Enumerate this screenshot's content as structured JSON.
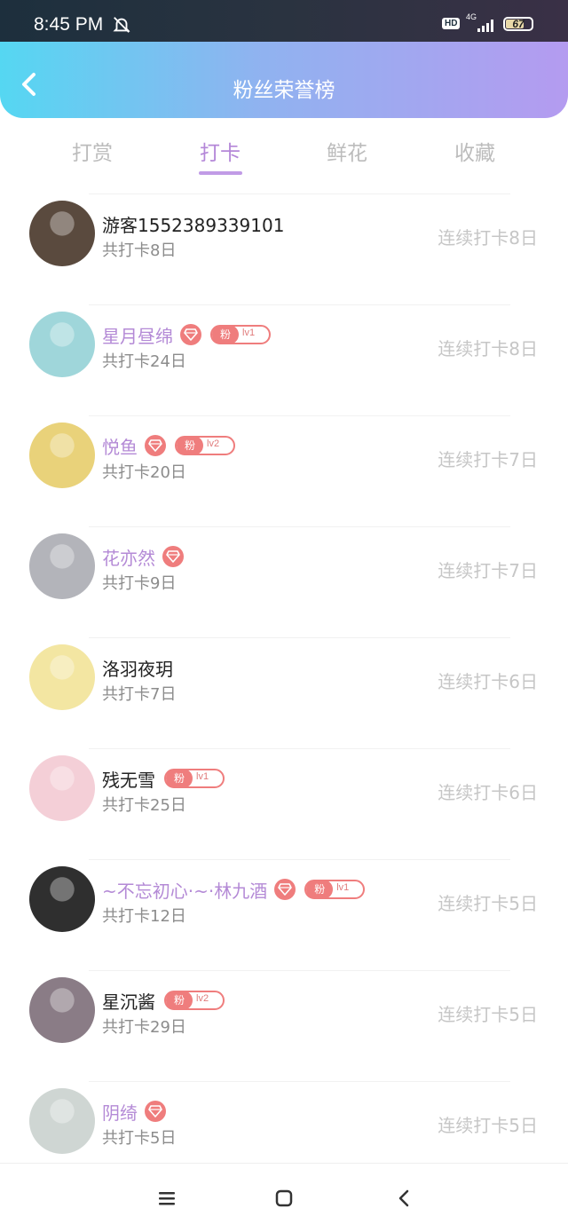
{
  "status_bar": {
    "time": "8:45 PM",
    "hd": "HD",
    "network": "4G",
    "battery": "67"
  },
  "header": {
    "title": "粉丝荣誉榜"
  },
  "tabs": [
    {
      "label": "打赏",
      "active": false
    },
    {
      "label": "打卡",
      "active": true
    },
    {
      "label": "鲜花",
      "active": false
    },
    {
      "label": "收藏",
      "active": false
    }
  ],
  "rows": [
    {
      "name": "游客1552389339101",
      "vip": false,
      "diamond": false,
      "fan_tag": "",
      "level": "",
      "total": "共打卡8日",
      "streak": "连续打卡8日",
      "avatar_color": "#5a4a3e"
    },
    {
      "name": "星月昼绵",
      "vip": true,
      "diamond": true,
      "fan_tag": "粉",
      "level": "lv1",
      "total": "共打卡24日",
      "streak": "连续打卡8日",
      "avatar_color": "#9fd6da"
    },
    {
      "name": "悦鱼",
      "vip": true,
      "diamond": true,
      "fan_tag": "粉",
      "level": "lv2",
      "total": "共打卡20日",
      "streak": "连续打卡7日",
      "avatar_color": "#e9d27a"
    },
    {
      "name": "花亦然",
      "vip": true,
      "diamond": true,
      "fan_tag": "",
      "level": "",
      "total": "共打卡9日",
      "streak": "连续打卡7日",
      "avatar_color": "#b3b4ba"
    },
    {
      "name": "洛羽夜玥",
      "vip": false,
      "diamond": false,
      "fan_tag": "",
      "level": "",
      "total": "共打卡7日",
      "streak": "连续打卡6日",
      "avatar_color": "#f3e6a2"
    },
    {
      "name": "残无雪",
      "vip": false,
      "diamond": false,
      "fan_tag": "粉",
      "level": "lv1",
      "total": "共打卡25日",
      "streak": "连续打卡6日",
      "avatar_color": "#f4cfd7"
    },
    {
      "name": "~不忘初心·~·林九酒",
      "vip": true,
      "diamond": true,
      "fan_tag": "粉",
      "level": "lv1",
      "total": "共打卡12日",
      "streak": "连续打卡5日",
      "avatar_color": "#2f2f2f"
    },
    {
      "name": "星沉酱",
      "vip": false,
      "diamond": false,
      "fan_tag": "粉",
      "level": "lv2",
      "total": "共打卡29日",
      "streak": "连续打卡5日",
      "avatar_color": "#8a7c86"
    },
    {
      "name": "阴绮",
      "vip": true,
      "diamond": true,
      "fan_tag": "",
      "level": "",
      "total": "共打卡5日",
      "streak": "连续打卡5日",
      "avatar_color": "#cfd6d3"
    }
  ],
  "colors": {
    "accent": "#b487d8",
    "badge": "#ef7d7d",
    "muted": "#c6c6c6"
  }
}
